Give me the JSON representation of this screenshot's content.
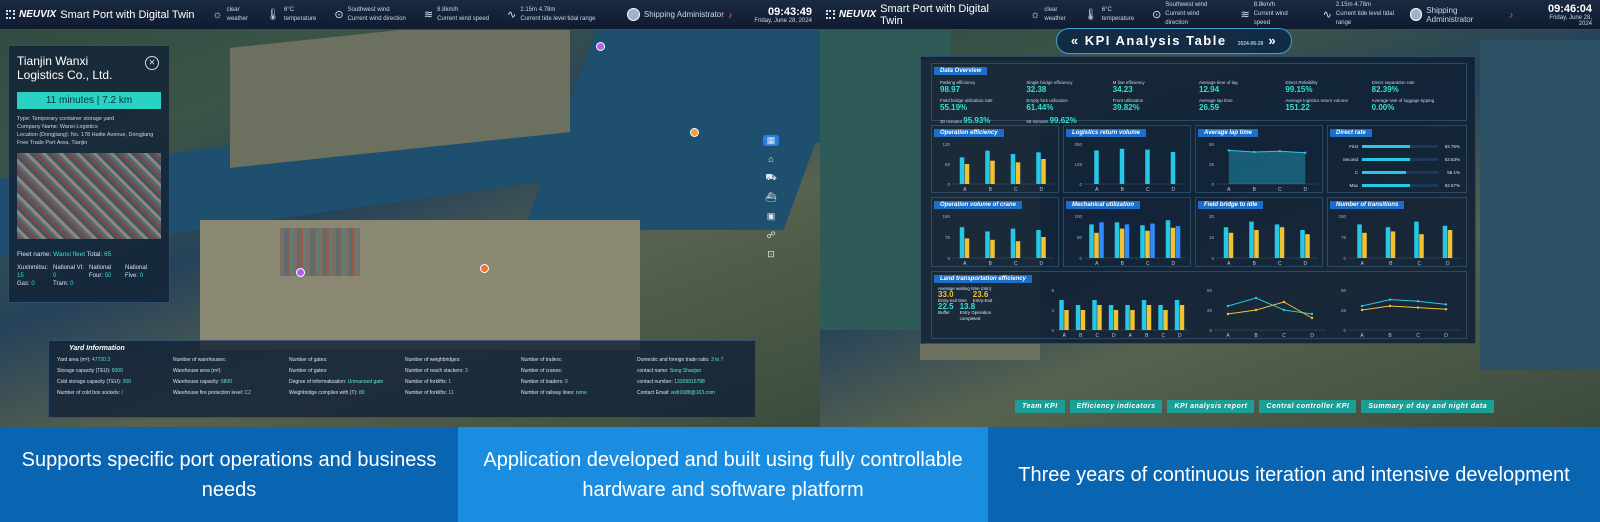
{
  "left": {
    "topbar": {
      "logo": "NEUVIX",
      "title": "Smart Port with Digital Twin",
      "weather": [
        {
          "icon": "sun-icon",
          "value": "clear",
          "label": "weather"
        },
        {
          "icon": "thermometer-icon",
          "value": "6°C",
          "label": "temperature"
        },
        {
          "icon": "wind-direction-icon",
          "value": "Southwest wind",
          "label": "Current wind direction"
        },
        {
          "icon": "wind-speed-icon",
          "value": "8.8km/h",
          "label": "Current wind speed"
        },
        {
          "icon": "tide-icon",
          "value": "2.15m 4.78m",
          "label": "Current tide level tidal range"
        }
      ],
      "user": "Shipping Administrator",
      "time": "09:43:49",
      "date": "Friday, June 28, 2024"
    },
    "company": {
      "name": "Tianjin Wanxi Logistics Co., Ltd.",
      "eta": "11 minutes | 7.2 km",
      "type": "Type: Temporary container storage yard",
      "company_name": "Company Name: Wanxi Logistics",
      "location": "Location (Dongjiang): No. 178 Haitie Avenue, Dongjiang Free Trade Port Area, Tianjin",
      "fleet_label": "Fleet name:",
      "fleet_value": "Wanxi fleet",
      "total_label": "Total:",
      "total_value": "65",
      "counts": [
        {
          "label": "Xuxinmitsu:",
          "value": "15"
        },
        {
          "label": "National VI:",
          "value": "0"
        },
        {
          "label": "National Four:",
          "value": "50"
        },
        {
          "label": "National Five:",
          "value": "0"
        },
        {
          "label": "Gas:",
          "value": "0"
        },
        {
          "label": "Tram:",
          "value": "0"
        },
        {
          "label": "",
          "value": ""
        },
        {
          "label": "",
          "value": ""
        }
      ]
    },
    "yard": {
      "title": "Yard Information",
      "cells": [
        [
          "Yard area (m²):",
          "47720.3"
        ],
        [
          "Number of warehouses:",
          ""
        ],
        [
          "Number of gates:",
          ""
        ],
        [
          "Number of weighbridges:",
          ""
        ],
        [
          "Number of trailers:",
          ""
        ],
        [
          "Domestic and foreign trade ratio:",
          "3 to 7"
        ],
        [
          "Storage capacity (TEU):",
          "5000"
        ],
        [
          "Warehouse area (m²):",
          ""
        ],
        [
          "Number of gates:",
          ""
        ],
        [
          "Number of reach stackers:",
          "3"
        ],
        [
          "Number of cranes:",
          ""
        ],
        [
          "contact name:",
          "Song Shaojun"
        ],
        [
          "Cold storage capacity (TEU):",
          "200"
        ],
        [
          "Warehouse capacity:",
          "5800"
        ],
        [
          "Degree of informatization:",
          "Unmanned gate"
        ],
        [
          "Number of forklifts:",
          "1"
        ],
        [
          "Number of loaders:",
          "0"
        ],
        [
          "contact number:",
          "13309915788"
        ],
        [
          "Number of cold box sockets:",
          "/"
        ],
        [
          "Warehouse fire protection level:",
          "C2"
        ],
        [
          "Weighbridge complies with (T):",
          "80"
        ],
        [
          "Number of forklifts:",
          "11"
        ],
        [
          "Number of railway lines:",
          "none"
        ],
        [
          "Contact Email:",
          "wxlt1688@163.com"
        ]
      ]
    }
  },
  "right": {
    "topbar": {
      "time": "09:46:04",
      "user": "Shipping Administrator"
    },
    "kpi_title": "KPI Analysis Table",
    "kpi_date": "2024-06-28",
    "overview": {
      "header": "Data Overview",
      "items": [
        {
          "label": "Parking efficiency",
          "value": "98.97"
        },
        {
          "label": "Single bridge efficiency",
          "value": "32.38"
        },
        {
          "label": "M line efficiency",
          "value": "34.23"
        },
        {
          "label": "Average time of lag",
          "value": "12.94"
        },
        {
          "label": "Direct Reliability",
          "value": "99.15%"
        },
        {
          "label": "Direct separation rate",
          "value": "82.39%"
        },
        {
          "label": "Field bridge utilization rate",
          "value": "55.19%"
        },
        {
          "label": "Empty fork utilization",
          "value": "61.44%"
        },
        {
          "label": "Front utilization",
          "value": "39.82%"
        },
        {
          "label": "Average lap time",
          "value": "26.59"
        },
        {
          "label": "Average logistics return volume",
          "value": "151.22"
        },
        {
          "label": "Average rate of luggage tipping",
          "value": "0.00%"
        }
      ],
      "extra": [
        {
          "label": "30 minutes",
          "value": "95.93%"
        },
        {
          "label": "60 minutes",
          "value": "99.62%"
        }
      ]
    },
    "sections": {
      "op_eff": "Operation efficiency",
      "logistics": "Logistics return volume",
      "lap": "Average lap time",
      "direct": "Direct rate",
      "crane": "Operation volume of crane",
      "mech": "Mechanical utilization",
      "field": "Field bridge to idle",
      "trans": "Number of transitions",
      "land": "Land transportation efficiency"
    },
    "direct_rate": [
      {
        "label": "First",
        "value": 62.75,
        "text": "62.75%"
      },
      {
        "label": "Second",
        "value": 62.63,
        "text": "62.63%"
      },
      {
        "label": "C",
        "value": 58.1,
        "text": "58.1%"
      },
      {
        "label": "Max",
        "value": 62.67,
        "text": "62.67%"
      }
    ],
    "land": {
      "wait_label": "Average waiting time (min)",
      "v1": "33.0",
      "l1": "Entry-exit time",
      "v2": "23.6",
      "l2": "Entry-Exit",
      "v3": "22.5",
      "l3": "Buffer",
      "v4": "13.8",
      "l4": "Entry Operation completed"
    },
    "buttons": [
      "Team KPI",
      "Efficiency indicators",
      "KPI analysis report",
      "Central controller KPI",
      "Summary of day and night data"
    ]
  },
  "chart_data": [
    {
      "type": "bar",
      "title": "Operation efficiency",
      "categories": [
        "A",
        "B",
        "C",
        "D"
      ],
      "series": [
        {
          "values": [
            80,
            100,
            90,
            95
          ]
        },
        {
          "values": [
            60,
            70,
            65,
            75
          ]
        }
      ],
      "ylim": [
        0,
        120
      ]
    },
    {
      "type": "bar",
      "title": "Logistics return volume",
      "categories": [
        "A",
        "B",
        "C",
        "D"
      ],
      "series": [
        {
          "values": [
            210,
            220,
            215,
            200
          ]
        }
      ],
      "ylim": [
        0,
        250
      ]
    },
    {
      "type": "area",
      "title": "Average lap time",
      "categories": [
        "A",
        "B",
        "C",
        "D"
      ],
      "series": [
        {
          "values": [
            42,
            40,
            41,
            39
          ]
        }
      ],
      "ylim": [
        0,
        50
      ]
    },
    {
      "type": "bar",
      "title": "Operation volume of crane",
      "categories": [
        "A",
        "B",
        "C",
        "D"
      ],
      "series": [
        {
          "values": [
            110,
            95,
            105,
            100
          ]
        },
        {
          "values": [
            70,
            65,
            60,
            75
          ]
        }
      ],
      "ylim": [
        0,
        150
      ]
    },
    {
      "type": "bar",
      "title": "Mechanical utilization",
      "categories": [
        "A",
        "B",
        "C",
        "D"
      ],
      "series": [
        {
          "values": [
            80,
            85,
            78,
            90
          ]
        },
        {
          "values": [
            60,
            70,
            65,
            72
          ]
        },
        {
          "values": [
            85,
            80,
            82,
            76
          ]
        }
      ],
      "ylim": [
        0,
        100
      ]
    },
    {
      "type": "bar",
      "title": "Field bridge to idle",
      "categories": [
        "A",
        "B",
        "C",
        "D"
      ],
      "series": [
        {
          "values": [
            22,
            26,
            24,
            20
          ]
        },
        {
          "values": [
            18,
            20,
            22,
            17
          ]
        }
      ],
      "ylim": [
        0,
        30
      ]
    },
    {
      "type": "bar",
      "title": "Number of transitions",
      "categories": [
        "A",
        "B",
        "C",
        "D"
      ],
      "series": [
        {
          "values": [
            120,
            110,
            130,
            115
          ]
        },
        {
          "values": [
            90,
            95,
            85,
            100
          ]
        }
      ],
      "ylim": [
        0,
        150
      ]
    },
    {
      "type": "bar",
      "title": "Land transportation efficiency",
      "categories": [
        "A",
        "B",
        "C",
        "D",
        "A",
        "B",
        "C",
        "D"
      ],
      "series": [
        {
          "values": [
            6,
            5,
            6,
            5,
            5,
            6,
            5,
            6
          ]
        },
        {
          "values": [
            4,
            4,
            5,
            4,
            4,
            5,
            4,
            5
          ]
        }
      ],
      "ylim": [
        0,
        8
      ]
    },
    {
      "type": "line",
      "title": "More than 120 minutes",
      "categories": [
        "A",
        "B",
        "C",
        "D"
      ],
      "series": [
        {
          "values": [
            30,
            40,
            25,
            20
          ]
        },
        {
          "values": [
            20,
            25,
            35,
            15
          ]
        }
      ],
      "ylim": [
        0,
        50
      ]
    },
    {
      "type": "line",
      "title": "Proportion of more than 60 minutes",
      "categories": [
        "A",
        "B",
        "C",
        "D"
      ],
      "series": [
        {
          "values": [
            30,
            38,
            36,
            32
          ]
        },
        {
          "values": [
            25,
            30,
            28,
            26
          ]
        }
      ],
      "ylim": [
        0,
        50
      ]
    }
  ],
  "captions": [
    "Supports specific port operations and business needs",
    "Application developed and built using fully controllable hardware and software platform",
    "Three years of continuous iteration and intensive development"
  ],
  "colors": {
    "accent": "#35e0d0",
    "panel": "#122236",
    "caption_dark": "#0964b2",
    "caption_light": "#1a8de0",
    "bar": "#26c8e8",
    "bar2": "#f2c230"
  }
}
